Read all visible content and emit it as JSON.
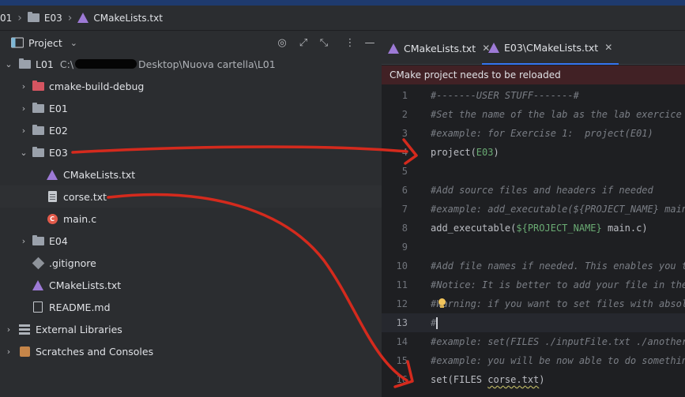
{
  "breadcrumb": {
    "root": "01",
    "folder": "E03",
    "file": "CMakeLists.txt"
  },
  "project_panel": {
    "title": "Project",
    "tools": [
      "locate-icon",
      "expand-all-icon",
      "collapse-all-icon",
      "more-icon",
      "minimize-icon"
    ],
    "root": {
      "name": "L01",
      "path": "C:\\",
      "path_tail": "Desktop\\Nuova cartella\\L01"
    },
    "items": [
      {
        "label": "cmake-build-debug",
        "icon": "folder-excluded-icon"
      },
      {
        "label": "E01",
        "icon": "folder-icon"
      },
      {
        "label": "E02",
        "icon": "folder-icon"
      },
      {
        "label": "E03",
        "icon": "folder-icon",
        "expanded": true
      },
      {
        "label": "CMakeLists.txt",
        "icon": "cmake-icon"
      },
      {
        "label": "corse.txt",
        "icon": "text-file-icon",
        "selected": true
      },
      {
        "label": "main.c",
        "icon": "c-file-icon"
      },
      {
        "label": "E04",
        "icon": "folder-icon"
      },
      {
        "label": ".gitignore",
        "icon": "git-file-icon"
      },
      {
        "label": "CMakeLists.txt",
        "icon": "cmake-icon"
      },
      {
        "label": "README.md",
        "icon": "markdown-icon"
      },
      {
        "label": "External Libraries",
        "icon": "library-icon"
      },
      {
        "label": "Scratches and Consoles",
        "icon": "scratch-icon"
      }
    ]
  },
  "editor": {
    "tabs": [
      {
        "label": "CMakeLists.txt",
        "active": false
      },
      {
        "label": "E03\\CMakeLists.txt",
        "active": true
      }
    ],
    "notice": "CMake project needs to be reloaded",
    "current_line": 13,
    "lines": [
      {
        "n": "1",
        "text": "#-------USER STUFF-------#"
      },
      {
        "n": "2",
        "text": "#Set the name of the lab as the lab exercice"
      },
      {
        "n": "3",
        "text": "#example: for Exercise 1:  project(E01)"
      },
      {
        "n": "4",
        "fn": "project(",
        "arg": "E03",
        "tail": ")"
      },
      {
        "n": "5",
        "text": ""
      },
      {
        "n": "6",
        "text": "#Add source files and headers if needed"
      },
      {
        "n": "7",
        "text": "#example: add_executable(${PROJECT_NAME} main."
      },
      {
        "n": "8",
        "fn": "add_executable(",
        "arg": "${PROJECT_NAME}",
        "tail": " main.c)"
      },
      {
        "n": "9",
        "text": ""
      },
      {
        "n": "10",
        "text": "#Add file names if needed. This enables you to"
      },
      {
        "n": "11",
        "text": "#Notice: It is better to add your file in the"
      },
      {
        "n": "12",
        "text": "#Warning: if you want to set files with absolu"
      },
      {
        "n": "13",
        "text": "#"
      },
      {
        "n": "14",
        "text": "#example: set(FILES ./inputFile.txt ./anotherI"
      },
      {
        "n": "15",
        "text": "#example: you will be now able to do something"
      },
      {
        "n": "16",
        "fn": "set(FILES ",
        "word": "corse.txt",
        "tail": ")"
      }
    ]
  },
  "colors": {
    "accent": "#3574f0",
    "notice_bg": "#412125",
    "annotation_red": "#d42a1d"
  }
}
